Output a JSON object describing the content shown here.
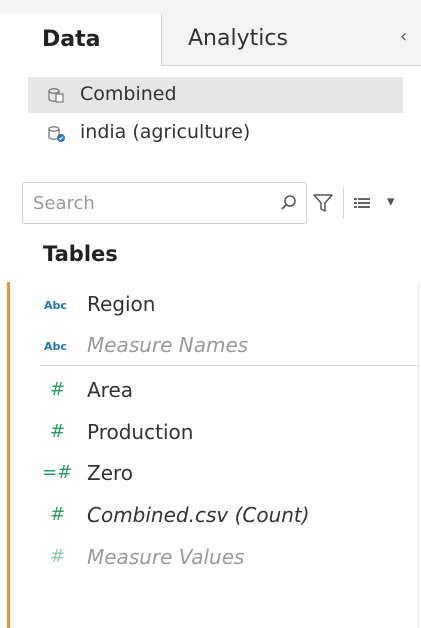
{
  "tabs": {
    "data": "Data",
    "analytics": "Analytics",
    "collapse_glyph": "‹"
  },
  "data_sources": [
    {
      "label": "Combined",
      "selected": true,
      "icon": "datasource-icon"
    },
    {
      "label": "india (agriculture)",
      "selected": false,
      "icon": "datasource-connected-icon"
    }
  ],
  "search": {
    "placeholder": "Search",
    "value": ""
  },
  "toolbar": {
    "view_glyph": "▾"
  },
  "section": {
    "title": "Tables"
  },
  "dimensions": [
    {
      "type": "Abc",
      "name": "Region",
      "italic": false,
      "faded": false
    },
    {
      "type": "Abc",
      "name": "Measure Names",
      "italic": true,
      "faded": true
    }
  ],
  "measures": [
    {
      "type": "#",
      "name": "Area",
      "italic": false,
      "faded": false
    },
    {
      "type": "#",
      "name": "Production",
      "italic": false,
      "faded": false
    },
    {
      "type": "=#",
      "name": "Zero",
      "italic": false,
      "faded": false
    },
    {
      "type": "#",
      "name": "Combined.csv (Count)",
      "italic": true,
      "faded": false
    },
    {
      "type": "#",
      "name": "Measure Values",
      "italic": true,
      "faded": true
    }
  ],
  "colors": {
    "accent": "#f28e2b",
    "dimension_icon": "#1f77b4",
    "measure_icon": "#2a9d5c",
    "selected_bg": "#e6e6e6"
  }
}
